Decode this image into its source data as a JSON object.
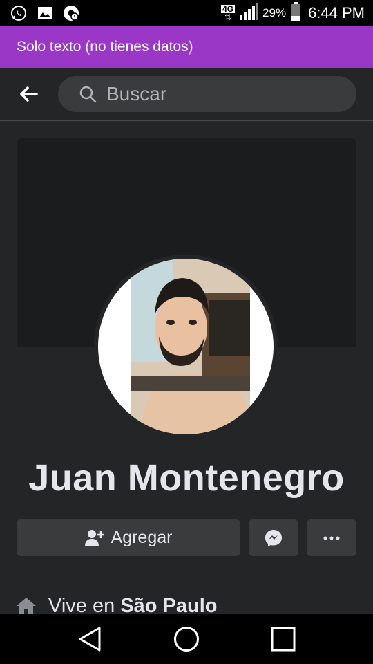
{
  "status_bar": {
    "time": "6:44 PM",
    "battery": "29%",
    "network": "4G",
    "icons": [
      "whatsapp-icon",
      "image-icon",
      "chrome-notification-icon",
      "network-4g-icon",
      "signal-icon",
      "battery-icon"
    ]
  },
  "banner": {
    "text": "Solo texto (no tienes datos)",
    "color": "#9b37c7"
  },
  "search": {
    "placeholder": "Buscar"
  },
  "profile": {
    "name": "Juan Montenegro",
    "add_label": "Agregar",
    "lives_prefix": "Vive en",
    "lives_city": "São Paulo"
  },
  "colors": {
    "background": "#242526",
    "button": "#3a3b3c",
    "text": "#e4e6eb"
  }
}
